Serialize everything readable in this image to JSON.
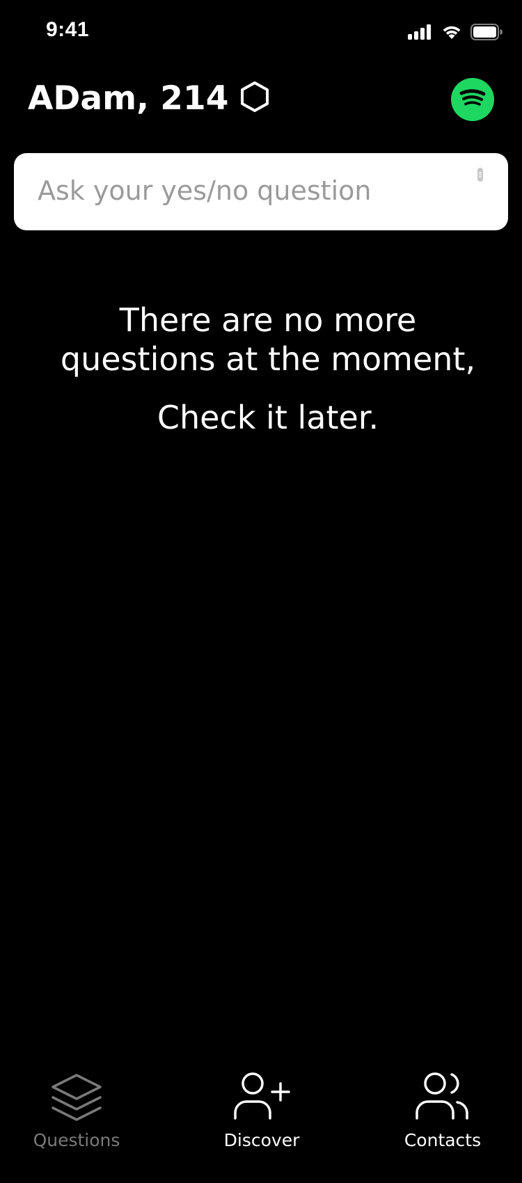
{
  "status_bar": {
    "time": "9:41",
    "icons": [
      "cellular-signal-icon",
      "wifi-icon",
      "battery-icon"
    ]
  },
  "header": {
    "user_name": "ADam, 214",
    "token_icon": "hexagon-icon",
    "spotify_icon": "spotify-icon",
    "spotify_color": "#1ed760"
  },
  "question_input": {
    "placeholder": "Ask your yes/no question",
    "value": ""
  },
  "empty_state": {
    "line1": "There are no more questions at the moment,",
    "line2": "Check it later."
  },
  "tabs": [
    {
      "label": "Questions",
      "icon": "layers-icon",
      "state": "inactive"
    },
    {
      "label": "Discover",
      "icon": "add-user-icon",
      "state": "active"
    },
    {
      "label": "Contacts",
      "icon": "users-icon",
      "state": "active"
    }
  ],
  "colors": {
    "background": "#000000",
    "text": "#ffffff",
    "inactive_tab": "#7a7a7a",
    "input_background": "#ffffff",
    "placeholder": "#9a9a9a"
  }
}
